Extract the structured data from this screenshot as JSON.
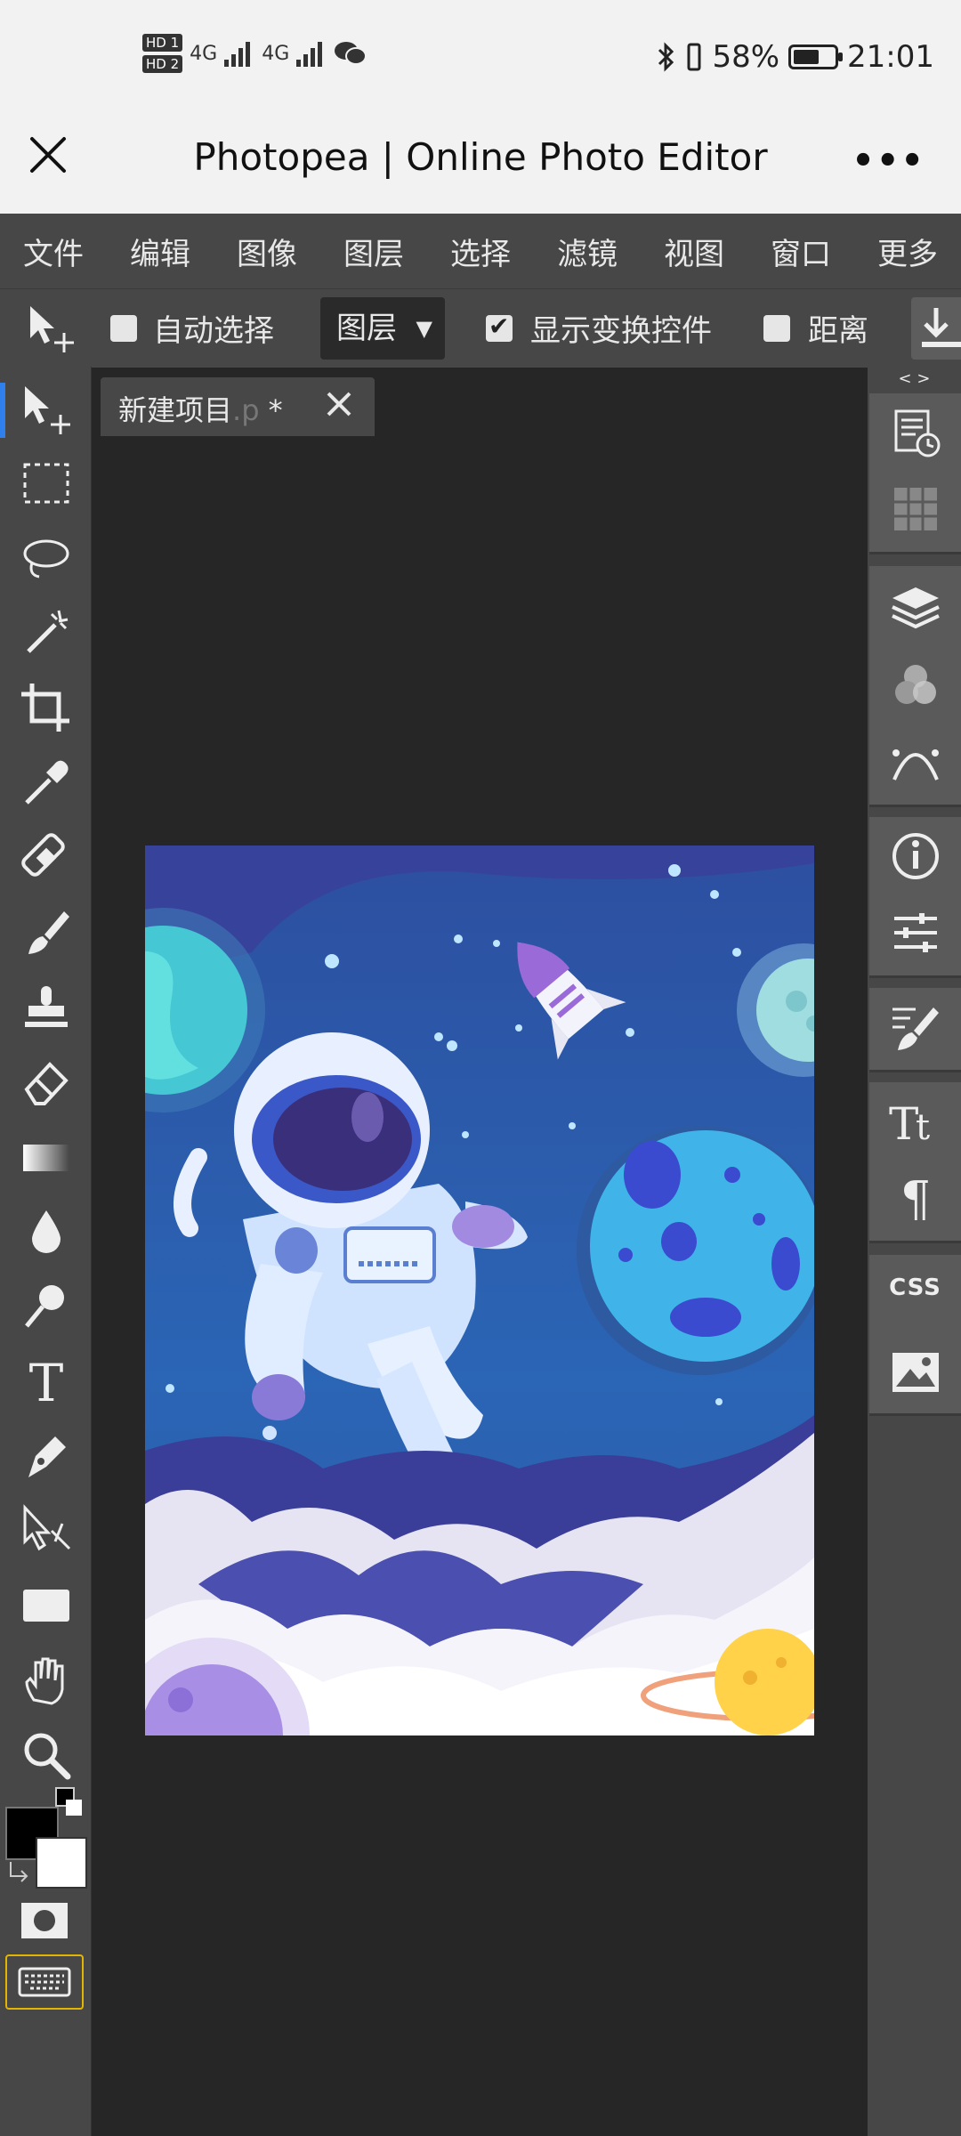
{
  "status_bar": {
    "hd1": "HD 1",
    "hd2": "HD 2",
    "net1": "4G",
    "net2": "4G",
    "battery_percent": "58%",
    "time": "21:01",
    "battery_level_percent": 58
  },
  "titlebar": {
    "title": "Photopea | Online Photo Editor",
    "more": "•••"
  },
  "menu": {
    "items": [
      {
        "label": "文件"
      },
      {
        "label": "编辑"
      },
      {
        "label": "图像"
      },
      {
        "label": "图层"
      },
      {
        "label": "选择"
      },
      {
        "label": "滤镜"
      },
      {
        "label": "视图"
      },
      {
        "label": "窗口"
      },
      {
        "label": "更多"
      }
    ]
  },
  "options": {
    "auto_select_label": "自动选择",
    "auto_select_checked": false,
    "layer_select_value": "图层",
    "transform_controls_label": "显示变换控件",
    "transform_controls_checked": true,
    "distance_label": "距离",
    "distance_checked": false
  },
  "document": {
    "tab_name_prefix": "新建项目",
    "tab_name_faint": ".p",
    "tab_modified": " *"
  },
  "right_panel": {
    "toggle": "< >",
    "css_label": "CSS"
  },
  "colors": {
    "accent": "#2f80ed",
    "foreground": "#000000",
    "background": "#ffffff",
    "keyboard_border": "#e3b400"
  }
}
